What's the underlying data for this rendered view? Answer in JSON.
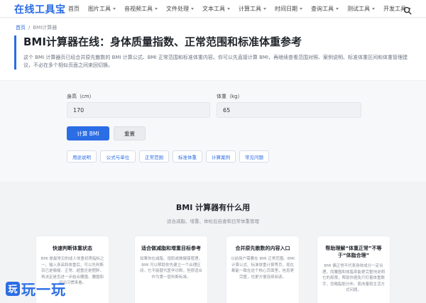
{
  "nav": {
    "logo": "在线工具宝",
    "items": [
      {
        "label": "首页",
        "dropdown": false
      },
      {
        "label": "图片工具",
        "dropdown": true
      },
      {
        "label": "音视频工具",
        "dropdown": true
      },
      {
        "label": "文件处理",
        "dropdown": true
      },
      {
        "label": "文本工具",
        "dropdown": true
      },
      {
        "label": "计算工具",
        "dropdown": true
      },
      {
        "label": "时间日期",
        "dropdown": true
      },
      {
        "label": "查询工具",
        "dropdown": true
      },
      {
        "label": "测试工具",
        "dropdown": true
      },
      {
        "label": "开发工具",
        "dropdown": true
      }
    ],
    "search_icon": "search-icon"
  },
  "breadcrumb": {
    "home": "首页",
    "sep": "/",
    "current": "BMI计算器"
  },
  "header": {
    "title": "BMI计算器在线：身体质量指数、正常范围和标准体重参考",
    "desc": "这个 BMI 计算器页已经合并原先散数的 BMI 计算公式、BMI 正常范围和标准体重内容。你可以先直接计算 BMI，再继续查看范围对照、案例说明、标准体重区间和体重管理建议，不必在多个相似页面之间来回切换。"
  },
  "form": {
    "height_label": "身高（cm）",
    "height_value": "170",
    "weight_label": "体重（kg）",
    "weight_value": "65",
    "calc_button": "计算 BMI",
    "reset_button": "重置"
  },
  "pills": [
    "用途说明",
    "公式与单位",
    "正常范围",
    "标准体重",
    "计算案例",
    "常见问题"
  ],
  "section": {
    "title": "BMI 计算器有什么用",
    "subtitle": "适合减脂、增重、体检后自查和日常体重管理",
    "cards": [
      {
        "title": "快速判断体重状态",
        "text": "BMI 是最常见的成人体重初筛指标之一，输入身高和体重后，可以先判断目已是偏瘦、正常、超重还是肥胖，再决定是否进一步结合腰围、腰围和运动习惯来看。"
      },
      {
        "title": "适合做减脂和增重目标参考",
        "text": "如果你在减脂、增肌或做健康管理，BMI 可以帮助你先建立一个合理区间，它不能替代医学诊断，但很适合作为第一层判断标准。"
      },
      {
        "title": "合并原先散数的内容入口",
        "text": "以前用户需要在 BMI 正常范围、BMI 计算公式、标准体重计算等页，现在都能一致在这个核心页面里，信息更完整，也更方便连续阅读。"
      },
      {
        "title": "帮助理解“体重正常”不等于“体脂合理”",
        "text": "BMI 偏正常不代表身体成分一定合理，而腰围和体脂率能更完整地说明它的局限，帮助你避免只盯着体重数字，忽略脂肪分布、肌肉量和生活方式问题。"
      }
    ]
  },
  "watermark": {
    "icon": "玩",
    "text": "玩一玩"
  },
  "colors": {
    "accent": "#2b6de5",
    "bg": "#f7f8fa"
  }
}
